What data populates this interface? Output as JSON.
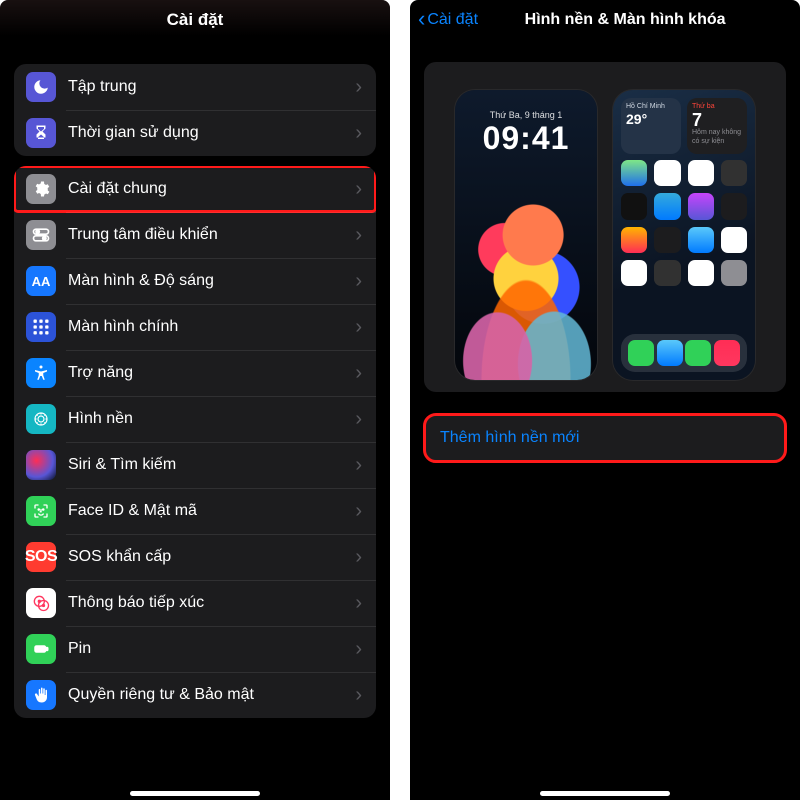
{
  "left": {
    "title": "Cài đặt",
    "group1": [
      {
        "label": "Tập trung",
        "icon": "moon-icon",
        "bg": "bg-indigo"
      },
      {
        "label": "Thời gian sử dụng",
        "icon": "hourglass-icon",
        "bg": "bg-hourglass"
      }
    ],
    "group2": [
      {
        "label": "Cài đặt chung",
        "icon": "gear-icon",
        "bg": "bg-grey",
        "highlight": true
      },
      {
        "label": "Trung tâm điều khiển",
        "icon": "toggles-icon",
        "bg": "bg-toggles"
      },
      {
        "label": "Màn hình & Độ sáng",
        "icon": "aa-icon",
        "bg": "bg-blue",
        "text": "AA"
      },
      {
        "label": "Màn hình chính",
        "icon": "app-grid-icon",
        "bg": "bg-bluegrid"
      },
      {
        "label": "Trợ năng",
        "icon": "accessibility-icon",
        "bg": "bg-access"
      },
      {
        "label": "Hình nền",
        "icon": "wallpaper-icon",
        "bg": "bg-cyan"
      },
      {
        "label": "Siri & Tìm kiếm",
        "icon": "siri-icon",
        "bg": "bg-siri"
      },
      {
        "label": "Face ID & Mật mã",
        "icon": "faceid-icon",
        "bg": "bg-green"
      },
      {
        "label": "SOS khẩn cấp",
        "icon": "sos-icon",
        "bg": "bg-red",
        "text": "SOS"
      },
      {
        "label": "Thông báo tiếp xúc",
        "icon": "exposure-icon",
        "bg": "bg-pink"
      },
      {
        "label": "Pin",
        "icon": "battery-icon",
        "bg": "bg-batt"
      },
      {
        "label": "Quyền riêng tư & Bảo mật",
        "icon": "hand-icon",
        "bg": "bg-hand"
      }
    ]
  },
  "right": {
    "back": "Cài đặt",
    "title": "Hình nền & Màn hình khóa",
    "lock_preview": {
      "date": "Thứ Ba, 9 tháng 1",
      "time": "09:41"
    },
    "home_preview": {
      "weather_city": "Hồ Chí Minh",
      "weather_temp": "29°",
      "cal_dow": "Thứ ba",
      "cal_day": "7",
      "cal_sub": "Hôm nay không có sự kiện"
    },
    "action": "Thêm hình nền mới"
  }
}
